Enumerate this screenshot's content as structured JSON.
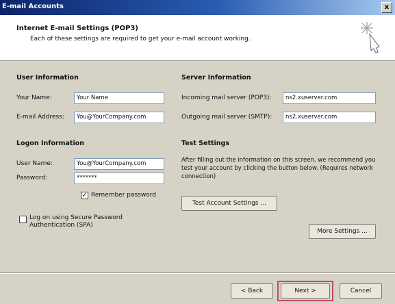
{
  "window": {
    "title": "E-mail Accounts",
    "close_glyph": "x"
  },
  "header": {
    "title": "Internet E-mail Settings (POP3)",
    "subtitle": "Each of these settings are required to get your e-mail account working."
  },
  "user_info": {
    "heading": "User Information",
    "name_label": "Your Name:",
    "name_value": "Your Name",
    "email_label": "E-mail Address:",
    "email_value": "You@YourCompany.com"
  },
  "server_info": {
    "heading": "Server Information",
    "incoming_label": "Incoming mail server (POP3):",
    "incoming_value": "ns2.xuserver.com",
    "outgoing_label": "Outgoing mail server (SMTP):",
    "outgoing_value": "ns2.xuserver.com"
  },
  "logon_info": {
    "heading": "Logon Information",
    "user_label": "User Name:",
    "user_value": "You@YourCompany.com",
    "password_label": "Password:",
    "password_value": "*******",
    "remember_label": "Remember password",
    "remember_checked": true,
    "spa_label": "Log on using Secure Password\nAuthentication (SPA)",
    "spa_checked": false
  },
  "test_settings": {
    "heading": "Test Settings",
    "description": "After filling out the information on this screen, we recommend you test your account by clicking the button below. (Requires network connection)",
    "test_button": "Test Account Settings ..."
  },
  "more_settings_button": "More Settings ...",
  "nav": {
    "back": "< Back",
    "next": "Next >",
    "cancel": "Cancel"
  },
  "check_glyph": "✓",
  "colors": {
    "highlight": "#c24a67",
    "title_bar": "#0a246a"
  }
}
